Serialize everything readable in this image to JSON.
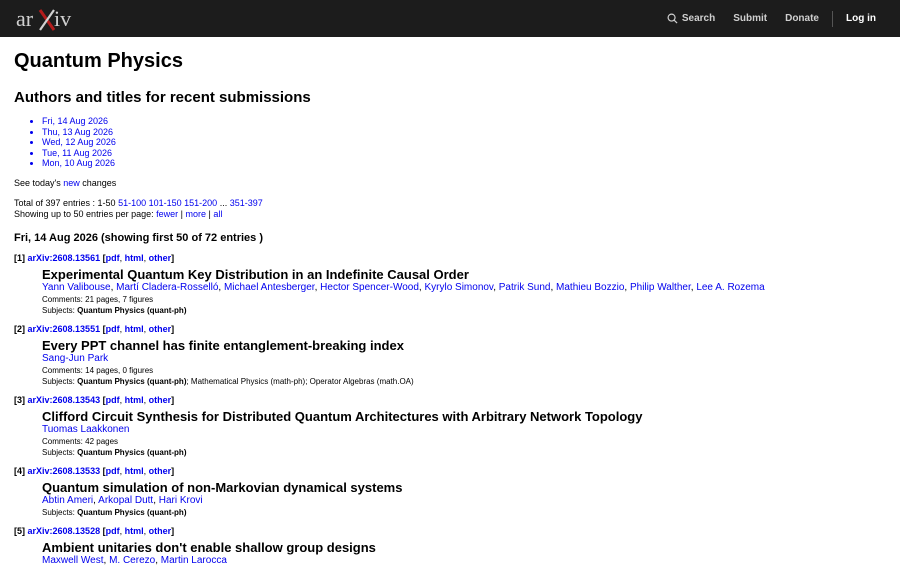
{
  "header": {
    "logo_text": "arXiv",
    "nav": {
      "search": "Search",
      "submit": "Submit",
      "donate": "Donate",
      "login": "Log in"
    }
  },
  "page": {
    "title": "Quantum Physics",
    "subtitle": "Authors and titles for recent submissions",
    "dates": [
      "Fri, 14 Aug 2026",
      "Thu, 13 Aug 2026",
      "Wed, 12 Aug 2026",
      "Tue, 11 Aug 2026",
      "Mon, 10 Aug 2026"
    ],
    "see_today_prefix": "See today's ",
    "see_today_link": "new",
    "see_today_suffix": " changes",
    "total_prefix": "Total of 397 entries : 1-50 ",
    "pages": [
      "51-100",
      "101-150",
      "151-200"
    ],
    "ellipsis": " ... ",
    "last_page": "351-397",
    "showing_prefix": "Showing up to 50 entries per page: ",
    "fewer": "fewer",
    "more": "more",
    "all": "all",
    "separator": " | ",
    "day_header": "Fri, 14 Aug 2026 (showing first 50 of 72 entries )"
  },
  "entries": [
    {
      "num": "[1]",
      "id": "arXiv:2608.13561",
      "title": "Experimental Quantum Key Distribution in an Indefinite Causal Order",
      "authors": [
        "Yann Valibouse",
        "Martí Cladera-Rosselló",
        "Michael Antesberger",
        "Hector Spencer-Wood",
        "Kyrylo Simonov",
        "Patrik Sund",
        "Mathieu Bozzio",
        "Philip Walther",
        "Lee A. Rozema"
      ],
      "comments": "21 pages, 7 figures",
      "subjects_primary": "Quantum Physics (quant-ph)",
      "subjects_rest": ""
    },
    {
      "num": "[2]",
      "id": "arXiv:2608.13551",
      "title": "Every PPT channel has finite entanglement-breaking index",
      "authors": [
        "Sang-Jun Park"
      ],
      "comments": "14 pages, 0 figures",
      "subjects_primary": "Quantum Physics (quant-ph)",
      "subjects_rest": "; Mathematical Physics (math-ph); Operator Algebras (math.OA)"
    },
    {
      "num": "[3]",
      "id": "arXiv:2608.13543",
      "title": "Clifford Circuit Synthesis for Distributed Quantum Architectures with Arbitrary Network Topology",
      "authors": [
        "Tuomas Laakkonen"
      ],
      "comments": "42 pages",
      "subjects_primary": "Quantum Physics (quant-ph)",
      "subjects_rest": ""
    },
    {
      "num": "[4]",
      "id": "arXiv:2608.13533",
      "title": "Quantum simulation of non-Markovian dynamical systems",
      "authors": [
        "Abtin Ameri",
        "Arkopal Dutt",
        "Hari Krovi"
      ],
      "comments": "",
      "subjects_primary": "Quantum Physics (quant-ph)",
      "subjects_rest": ""
    },
    {
      "num": "[5]",
      "id": "arXiv:2608.13528",
      "title": "Ambient unitaries don't enable shallow group designs",
      "authors": [
        "Maxwell West",
        "M. Cerezo",
        "Martin Larocca"
      ],
      "comments": "",
      "subjects_primary": "",
      "subjects_rest": ""
    }
  ],
  "labels": {
    "pdf": "pdf",
    "html": "html",
    "other": "other",
    "comments": "Comments: ",
    "subjects": "Subjects: "
  }
}
